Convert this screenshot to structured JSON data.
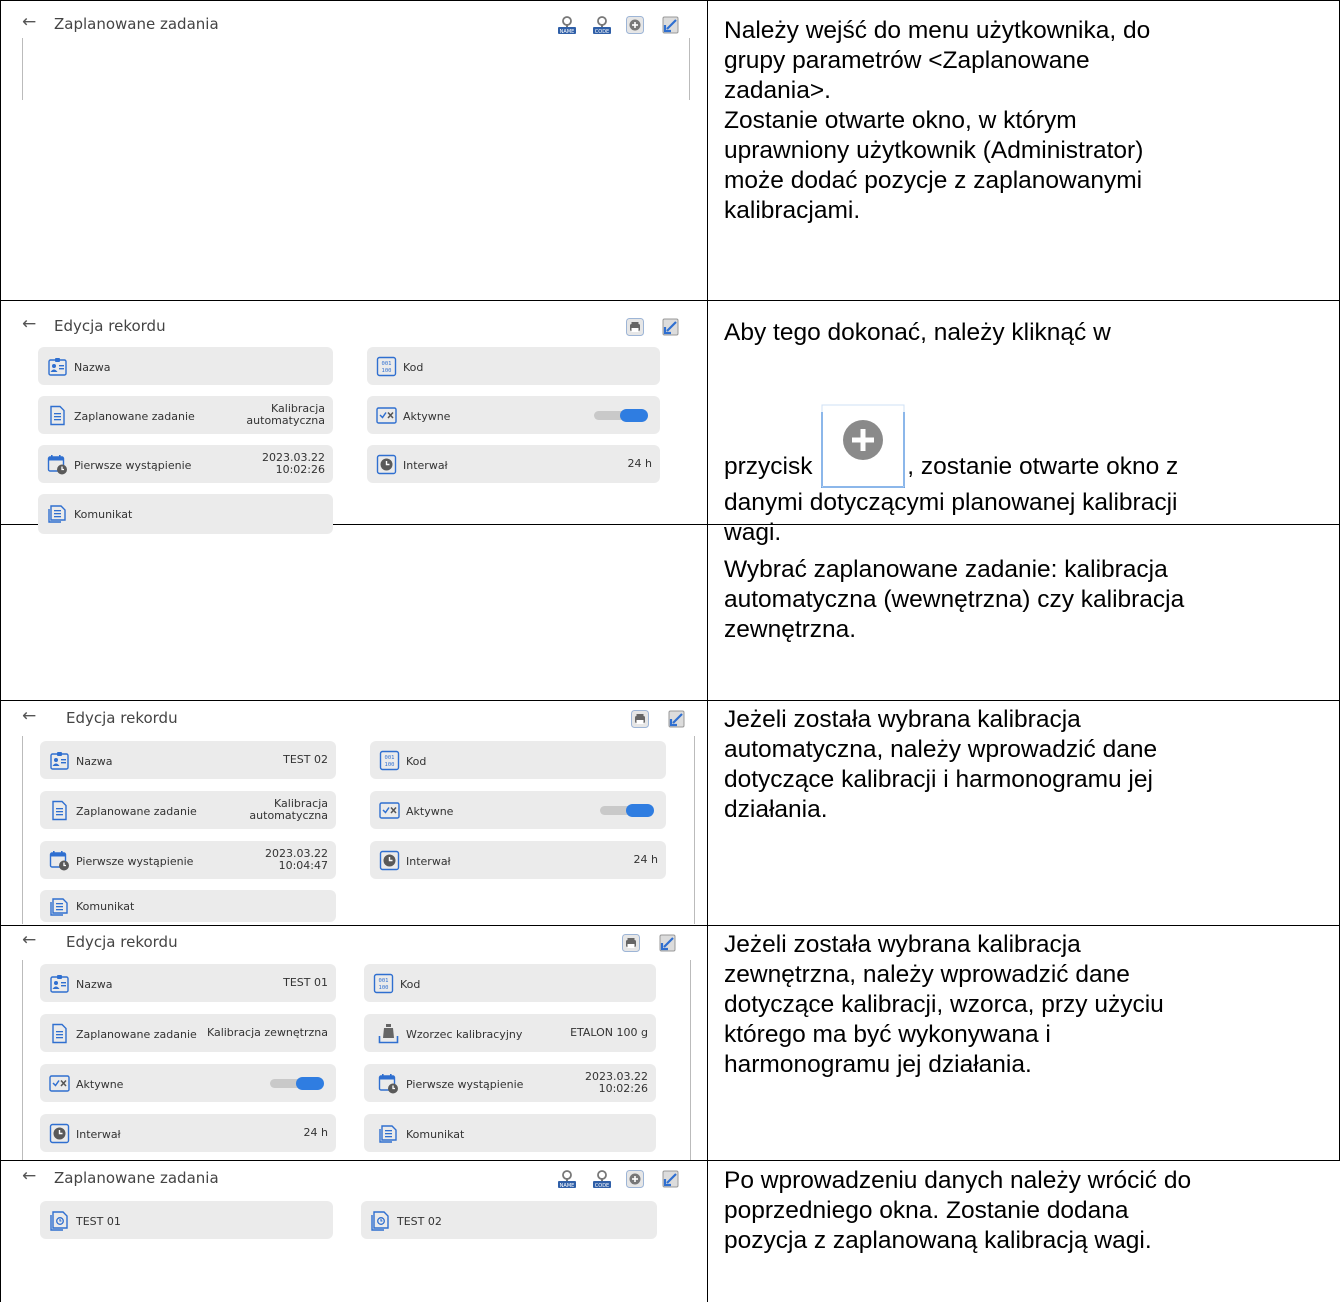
{
  "rows": [
    {
      "panel": {
        "title": "Zaplanowane zadania",
        "back": "←"
      },
      "desc": [
        "Należy wejść do menu użytkownika, do",
        "grupy parametrów <Zaplanowane",
        "zadania>.",
        "Zostanie otwarte okno, w którym",
        "uprawniony użytkownik (Administrator)",
        "może dodać pozycje z zaplanowanymi",
        "kalibracjami."
      ]
    },
    {
      "panel": {
        "title": "Edycja rekordu",
        "back": "←",
        "cards": [
          {
            "label": "Nazwa"
          },
          {
            "label": "Kod"
          },
          {
            "label": "Zaplanowane zadanie",
            "value": [
              "Kalibracja",
              "automatyczna"
            ]
          },
          {
            "label": "Aktywne"
          },
          {
            "label": "Pierwsze wystąpienie",
            "value": [
              "2023.03.22",
              "10:02:26"
            ]
          },
          {
            "label": "Interwał",
            "value": [
              "24 h"
            ]
          },
          {
            "label": "Komunikat"
          }
        ]
      },
      "desc": [
        "Aby tego dokonać, należy kliknąć w",
        "",
        "przycisk",
        ", zostanie otwarte okno z",
        "danymi dotyczącymi planowanej kalibracji",
        "wagi."
      ]
    },
    {
      "desc": [
        "Wybrać zaplanowane zadanie: kalibracja",
        "automatyczna (wewnętrzna) czy kalibracja",
        "zewnętrzna."
      ]
    },
    {
      "panel": {
        "title": "Edycja rekordu",
        "back": "←",
        "cards": [
          {
            "label": "Nazwa",
            "value": [
              "TEST 02"
            ]
          },
          {
            "label": "Kod"
          },
          {
            "label": "Zaplanowane zadanie",
            "value": [
              "Kalibracja",
              "automatyczna"
            ]
          },
          {
            "label": "Aktywne"
          },
          {
            "label": "Pierwsze wystąpienie",
            "value": [
              "2023.03.22",
              "10:04:47"
            ]
          },
          {
            "label": "Interwał",
            "value": [
              "24 h"
            ]
          },
          {
            "label": "Komunikat"
          }
        ]
      },
      "desc": [
        "Jeżeli została wybrana kalibracja",
        "automatyczna, należy wprowadzić dane",
        "dotyczące kalibracji i harmonogramu jej",
        "działania."
      ]
    },
    {
      "panel": {
        "title": "Edycja rekordu",
        "back": "←",
        "cards": [
          {
            "label": "Nazwa",
            "value": [
              "TEST 01"
            ]
          },
          {
            "label": "Kod"
          },
          {
            "label": "Zaplanowane zadanie",
            "value": [
              "Kalibracja zewnętrzna"
            ]
          },
          {
            "label": "Wzorzec kalibracyjny",
            "value": [
              "ETALON 100 g"
            ]
          },
          {
            "label": "Aktywne"
          },
          {
            "label": "Pierwsze wystąpienie",
            "value": [
              "2023.03.22",
              "10:02:26"
            ]
          },
          {
            "label": "Interwał",
            "value": [
              "24 h"
            ]
          },
          {
            "label": "Komunikat"
          }
        ]
      },
      "desc": [
        "Jeżeli została wybrana kalibracja",
        "zewnętrzna, należy wprowadzić dane",
        "dotyczące kalibracji, wzorca, przy użyciu",
        "którego ma być wykonywana i",
        "harmonogramu jej działania."
      ]
    },
    {
      "panel": {
        "title": "Zaplanowane zadania",
        "back": "←",
        "cards": [
          {
            "label": "TEST 01"
          },
          {
            "label": "TEST 02"
          }
        ]
      },
      "desc": [
        "Po wprowadzeniu danych należy wrócić do",
        "poprzedniego okna. Zostanie dodana",
        "pozycja z zaplanowaną kalibracją wagi."
      ]
    }
  ],
  "icon_badges": {
    "name": "NAME",
    "code": "CODE",
    "code_card": [
      "001",
      "100"
    ]
  },
  "colors": {
    "card_bg": "#ebebeb",
    "toggle_on": "#2f7de1",
    "icon_blue": "#2f6fd0",
    "border": "#000000"
  }
}
